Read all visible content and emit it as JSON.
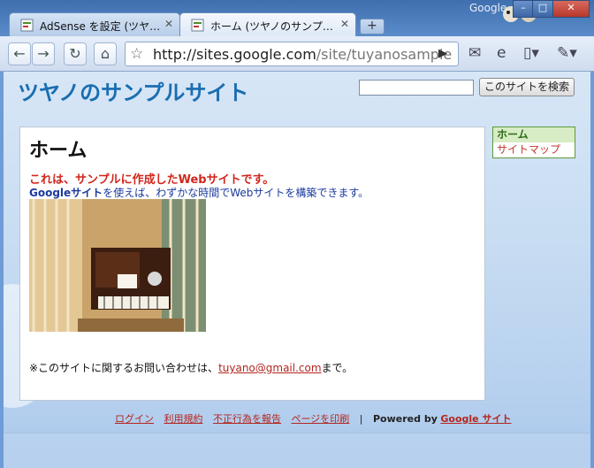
{
  "browser": {
    "tabs": [
      {
        "label": "AdSense を設定 (ツヤ…",
        "active": false
      },
      {
        "label": "ホーム (ツヤノのサンプ…",
        "active": true
      }
    ],
    "new_tab_label": "+",
    "google_label": "Google",
    "window_controls": {
      "minimize": "–",
      "maximize": "□",
      "close": "✕"
    },
    "url_host": "http://sites.google.com",
    "url_path": "/site/tuyanosample"
  },
  "page": {
    "site_title": "ツヤノのサンプルサイト",
    "search_button": "このサイトを検索",
    "search_value": "",
    "sidebar": [
      {
        "label": "ホーム",
        "active": true
      },
      {
        "label": "サイトマップ",
        "active": false
      }
    ],
    "heading": "ホーム",
    "intro_red": "これは、サンプルに作成したWebサイトです。",
    "intro_blue_bold": "Googleサイト",
    "intro_blue_rest": "を使えば、わずかな時間でWebサイトを構築できます。",
    "contact_prefix": "※このサイトに関するお問い合わせは、",
    "contact_email": "tuyano@gmail.com",
    "contact_suffix": "まで。",
    "footer": {
      "links": [
        "ログイン",
        "利用規約",
        "不正行為を報告",
        "ページを印刷"
      ],
      "separator": "|",
      "powered_by": "Powered by",
      "powered_link": "Google サイト"
    }
  },
  "colors": {
    "title_blue": "#1a6eb0",
    "intro_red": "#d1261c",
    "intro_blue": "#1b3a9e",
    "link_red": "#b3261e",
    "sidebar_border": "#5b9a3c"
  }
}
